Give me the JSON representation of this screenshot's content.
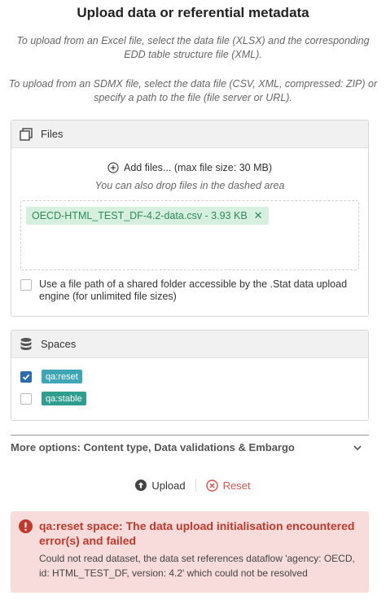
{
  "title": "Upload data or referential metadata",
  "hints": {
    "excel": "To upload from an Excel file, select the data file (XLSX) and the corresponding EDD table structure file (XML).",
    "sdmx": "To upload from an SDMX file, select the data file (CSV, XML, compressed: ZIP) or specify a path to the file (file server or URL)."
  },
  "files_panel": {
    "title": "Files",
    "add_files_label": "Add files... (max file size: 30 MB)",
    "drop_hint": "You can also drop files in the dashed area",
    "uploaded_file": "OECD-HTML_TEST_DF-4.2-data.csv - 3.93 KB",
    "remove_icon": "close-icon",
    "shared_folder_label": "Use a file path of a shared folder accessible by the .Stat data upload engine (for unlimited file sizes)",
    "shared_folder_checked": false
  },
  "spaces_panel": {
    "title": "Spaces",
    "spaces": [
      {
        "label": "qa:reset",
        "checked": true,
        "color": "#3fa6b8"
      },
      {
        "label": "qa:stable",
        "checked": false,
        "color": "#2f9e8f"
      }
    ]
  },
  "more_options": {
    "label": "More options: Content type, Data validations & Embargo",
    "icon": "chevron-down-icon"
  },
  "actions": {
    "upload_label": "Upload",
    "reset_label": "Reset"
  },
  "alert": {
    "title": "qa:reset space: The data upload initialisation encountered error(s) and failed",
    "body": "Could not read dataset, the data set references dataflow 'agency: OECD, id: HTML_TEST_DF, version: 4.2' which could not be resolved",
    "color": "#c0392b"
  },
  "colors": {
    "accent": "#2b6cb0",
    "file_chip_bg": "#d6efdf",
    "file_chip_text": "#2e8b57",
    "alert_bg": "#f8dbdb",
    "reset": "#d9534f"
  }
}
